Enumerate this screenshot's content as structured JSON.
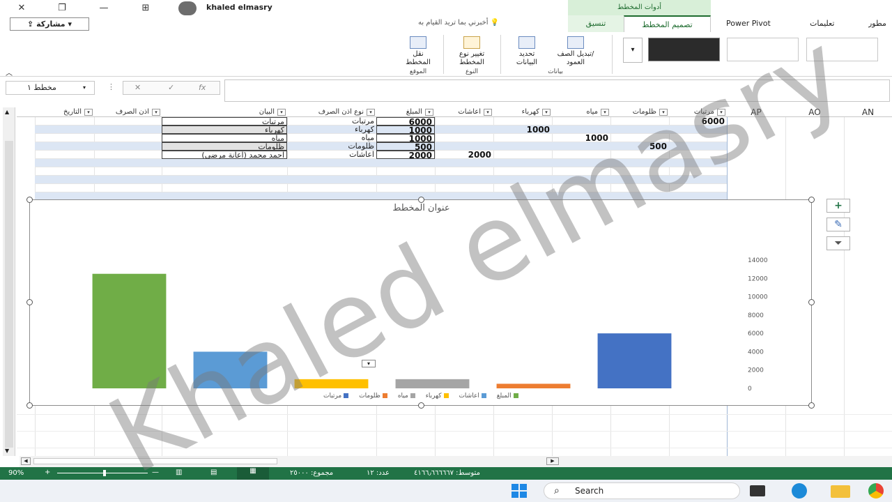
{
  "window": {
    "user_name": "khaled elmasry",
    "close_glyph": "✕",
    "restore_glyph": "❐",
    "minimize_glyph": "—"
  },
  "ribbon_context": {
    "group_label": "أدوات المخطط"
  },
  "tabs": [
    {
      "label": "تصميم المخطط",
      "active": true,
      "contextual": true
    },
    {
      "label": "تنسيق",
      "contextual": true
    },
    {
      "label": "Power Pivot"
    },
    {
      "label": "تعليمات"
    },
    {
      "label": "مطور"
    }
  ],
  "share": {
    "label": "مشاركة"
  },
  "tellme": {
    "placeholder": "أخبرني بما تريد القيام به"
  },
  "ribbon": {
    "groups": [
      {
        "label": "الموقع",
        "buttons": [
          "نقل",
          "المخطط"
        ]
      },
      {
        "label": "النوع",
        "buttons": [
          "تغيير نوع",
          "المخطط"
        ]
      },
      {
        "label": "بيانات",
        "buttons": [
          "تحديد",
          "البيانات",
          "تبديل الصف/",
          "العمود"
        ]
      }
    ]
  },
  "namebox": {
    "value": "مخطط ١"
  },
  "fx": {
    "label": "fx"
  },
  "columns": {
    "letters": [
      "AP",
      "AO",
      "AN"
    ],
    "headers": [
      "مرتبات",
      "ظلومات",
      "مياه",
      "كهرباء",
      "اعاشات",
      "المبلغ",
      "نوع اذن الصرف",
      "البيان",
      "اذن الصرف",
      "التاريخ"
    ]
  },
  "rows": [
    {
      "bayan": "مرتبات",
      "type": "مرتبات",
      "amount": "6000",
      "col_murtabat": "6000"
    },
    {
      "bayan": "كهرباء",
      "type": "كهرباء",
      "amount": "1000",
      "col_kahraba": "1000"
    },
    {
      "bayan": "مياه",
      "type": "مياه",
      "amount": "1000",
      "col_mayah": "1000"
    },
    {
      "bayan": "ظلومات",
      "type": "ظلومات",
      "amount": "500",
      "col_zalumat": "500"
    },
    {
      "bayan": "احمد محمد (اعانة مرضى)",
      "type": "اعاشات",
      "amount": "2000",
      "col_iaashat": "2000"
    }
  ],
  "chart_data": {
    "type": "bar",
    "title": "عنوان المخطط",
    "categories": [
      "المبلغ",
      "اعاشات",
      "كهرباء",
      "مياه",
      "ظلومات",
      "مرتبات"
    ],
    "values": [
      12500,
      4000,
      1000,
      1000,
      500,
      6000
    ],
    "colors": [
      "#70ad47",
      "#5b9bd5",
      "#ffc000",
      "#a5a5a5",
      "#ed7d31",
      "#4472c4"
    ],
    "ylim": [
      0,
      14000
    ],
    "yticks": [
      "14000",
      "12000",
      "10000",
      "8000",
      "6000",
      "4000",
      "2000",
      "0"
    ],
    "legend": [
      "مرتبات",
      "ظلومات",
      "مياه",
      "كهرباء",
      "اعاشات",
      "المبلغ"
    ],
    "legend_position": "bottom",
    "grid": false
  },
  "status": {
    "zoom": "90%",
    "average": "متوسط: ٤١٦٦٫٦٦٦٦٦٧",
    "count": "عدد: ١٢",
    "sum": "مجموع: ٢٥٠٠٠"
  },
  "taskbar": {
    "search_label": "Search"
  },
  "watermark": {
    "text": "Khaled elmasry"
  }
}
